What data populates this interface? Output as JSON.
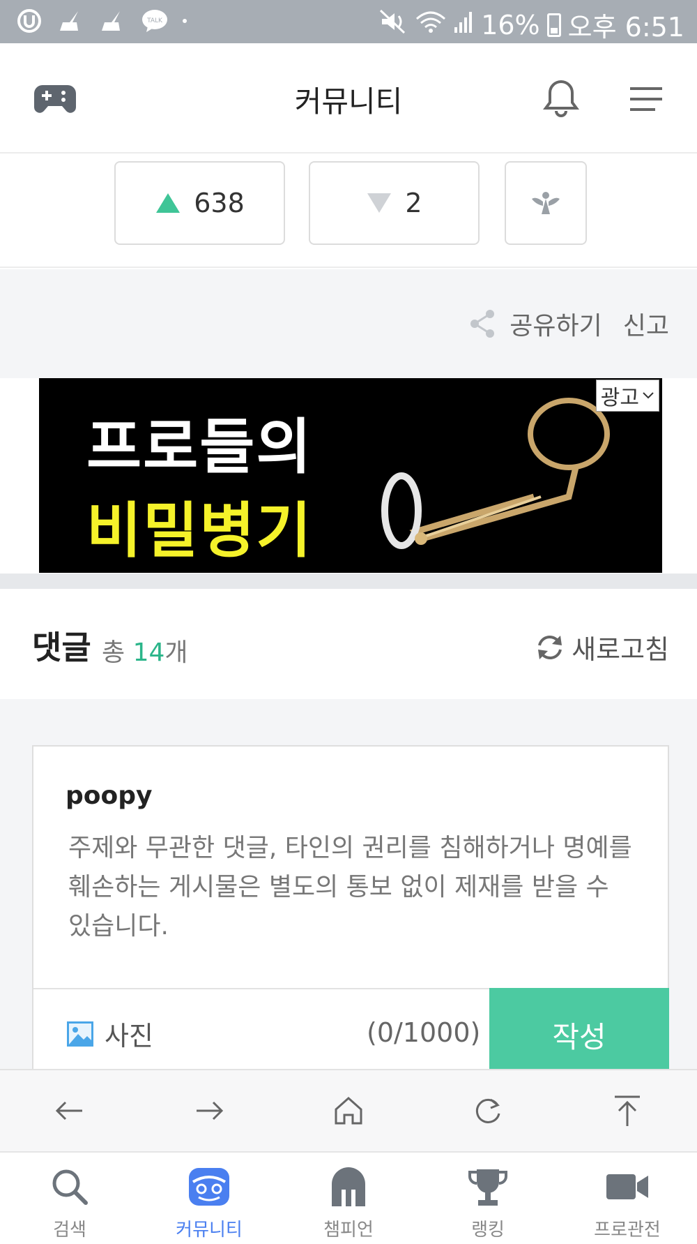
{
  "status_bar": {
    "battery": "16%",
    "time": "오후 6:51",
    "icons": [
      "u-plus-icon",
      "broom-icon",
      "broom-icon",
      "talk-icon",
      "mute-icon",
      "wifi-icon",
      "signal-icon",
      "battery-icon"
    ],
    "talk_text": "TALK"
  },
  "header": {
    "title": "커뮤니티",
    "left_icon": "gamepad-icon",
    "right_icons": [
      "bell-icon",
      "menu-icon"
    ]
  },
  "votes": {
    "up_count": "638",
    "down_count": "2",
    "up_color": "#3fc597",
    "down_color": "#cfd2d6",
    "third_icon": "angel-icon"
  },
  "share": {
    "share_label": "공유하기",
    "report_label": "신고"
  },
  "ad": {
    "line1": "프로들의",
    "line2": "비밀병기",
    "ad_label": "광고"
  },
  "comments": {
    "title": "댓글",
    "total_prefix": "총",
    "count": "14",
    "count_suffix": "개",
    "refresh_label": "새로고침"
  },
  "comment_form": {
    "username": "poopy",
    "placeholder": "주제와 무관한 댓글, 타인의 권리를 침해하거나 명예를 훼손하는 게시물은 별도의 통보 없이 제재를 받을 수 있습니다.",
    "photo_label": "사진",
    "char_count": "(0/1000)",
    "submit_label": "작성",
    "accent_color": "#4ccaa1"
  },
  "browser_nav": {
    "items": [
      "back-arrow-icon",
      "forward-arrow-icon",
      "home-icon",
      "reload-icon",
      "scroll-top-icon"
    ]
  },
  "tabs": {
    "items": [
      {
        "label": "검색",
        "icon": "search-icon"
      },
      {
        "label": "커뮤니티",
        "icon": "community-icon",
        "active": true
      },
      {
        "label": "챔피언",
        "icon": "helmet-icon"
      },
      {
        "label": "랭킹",
        "icon": "trophy-icon"
      },
      {
        "label": "프로관전",
        "icon": "video-camera-icon"
      }
    ],
    "active_color": "#4a7ff0"
  }
}
